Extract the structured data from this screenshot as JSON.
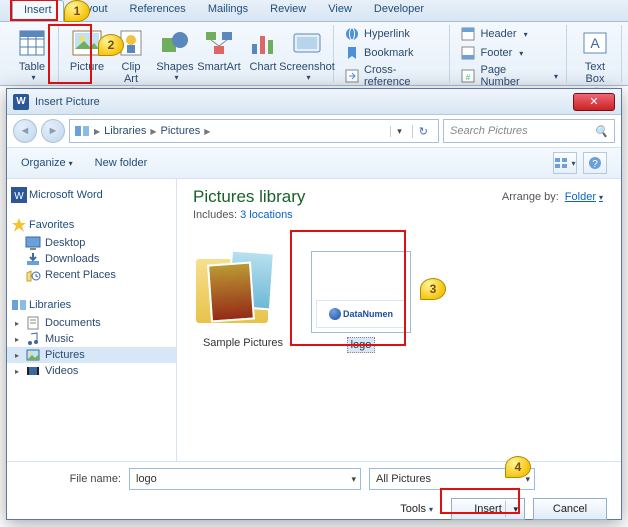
{
  "ribbon": {
    "tabs": [
      "Insert",
      "Layout",
      "References",
      "Mailings",
      "Review",
      "View",
      "Developer"
    ],
    "active": "Insert",
    "buttons": {
      "table": "Table",
      "picture": "Picture",
      "clipart": "Clip\nArt",
      "shapes": "Shapes",
      "smartart": "SmartArt",
      "chart": "Chart",
      "screenshot": "Screenshot",
      "hyperlink": "Hyperlink",
      "bookmark": "Bookmark",
      "crossref": "Cross-reference",
      "header": "Header",
      "footer": "Footer",
      "pagenum": "Page Number",
      "textbox": "Text\nBox"
    }
  },
  "dialog": {
    "title": "Insert Picture",
    "breadcrumb": [
      "Libraries",
      "Pictures"
    ],
    "search_placeholder": "Search Pictures",
    "organize": "Organize",
    "newfolder": "New folder",
    "microsoft_word": "Microsoft Word",
    "favorites": "Favorites",
    "fav_items": [
      "Desktop",
      "Downloads",
      "Recent Places"
    ],
    "libraries": "Libraries",
    "lib_items": [
      "Documents",
      "Music",
      "Pictures",
      "Videos"
    ],
    "lib_title": "Pictures library",
    "lib_sub_prefix": "Includes:",
    "lib_sub_link": "3 locations",
    "arrange_by": "Arrange by:",
    "arrange_val": "Folder",
    "files": {
      "sample": "Sample Pictures",
      "logo": "logo",
      "logo_brand": "DataNumen"
    },
    "filename_label": "File name:",
    "filename_value": "logo",
    "filter": "All Pictures",
    "tools": "Tools",
    "insert": "Insert",
    "cancel": "Cancel"
  },
  "callouts": {
    "c1": "1",
    "c2": "2",
    "c3": "3",
    "c4": "4"
  }
}
